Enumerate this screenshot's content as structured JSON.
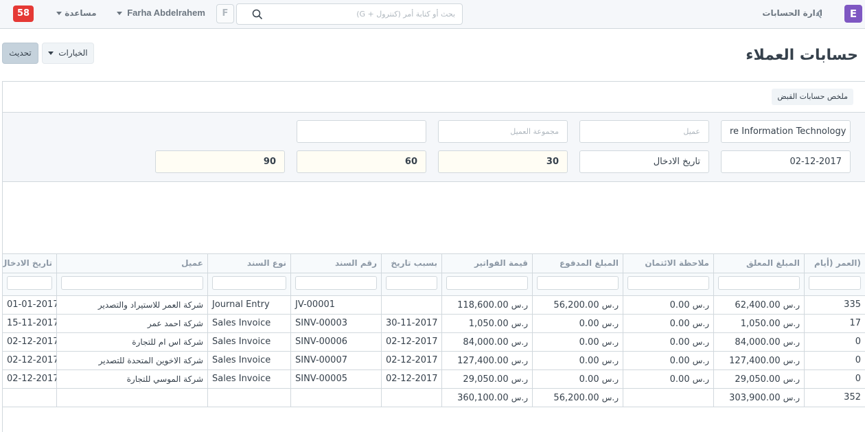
{
  "navbar": {
    "notification_count": "58",
    "help_label": "مساعدة",
    "user_name": "Farha Abdelrahem",
    "avatar_initial": "F",
    "search_placeholder": "بحث أو كتابة أمر (كنترول + G)",
    "breadcrumb": "ادارة الحسابات",
    "logo_letter": "E"
  },
  "page": {
    "title": "حسابات العملاء",
    "options_label": "الخيارات",
    "refresh_label": "تحديث",
    "summary_button": "ملخص حسابات القبض"
  },
  "filters": {
    "company": "re Information Technology",
    "customer_placeholder": "عميل",
    "customer_group_placeholder": "مجموعة العميل",
    "extra_field": "",
    "date": "02-12-2017",
    "ageing_based_on": "تاريخ الادخال",
    "range1": "30",
    "range2": "60",
    "range3": "90"
  },
  "table": {
    "columns": [
      "(العمر (أيام",
      "المبلغ المعلق",
      "ملاحظة الائتمان",
      "المبلغ المدفوع",
      "قيمة الفواتير",
      "بسبب تاريخ",
      "رقم السند",
      "نوع السند",
      "عميل",
      "تاريخ الادخال"
    ],
    "rows": [
      {
        "age": "335",
        "outstanding": "62,400.00",
        "credit_note": "0.00",
        "paid": "56,200.00",
        "invoiced": "118,600.00",
        "due_date": "",
        "voucher_no": "JV-00001",
        "voucher_type": "Journal Entry",
        "customer": "شركة العمر للاستيراد والتصدير",
        "posting_date": "01-01-2017"
      },
      {
        "age": "17",
        "outstanding": "1,050.00",
        "credit_note": "0.00",
        "paid": "0.00",
        "invoiced": "1,050.00",
        "due_date": "30-11-2017",
        "voucher_no": "SINV-00003",
        "voucher_type": "Sales Invoice",
        "customer": "شركة احمد عمر",
        "posting_date": "15-11-2017"
      },
      {
        "age": "0",
        "outstanding": "84,000.00",
        "credit_note": "0.00",
        "paid": "0.00",
        "invoiced": "84,000.00",
        "due_date": "02-12-2017",
        "voucher_no": "SINV-00006",
        "voucher_type": "Sales Invoice",
        "customer": "شركة اس ام للتجارة",
        "posting_date": "02-12-2017"
      },
      {
        "age": "0",
        "outstanding": "127,400.00",
        "credit_note": "0.00",
        "paid": "0.00",
        "invoiced": "127,400.00",
        "due_date": "02-12-2017",
        "voucher_no": "SINV-00007",
        "voucher_type": "Sales Invoice",
        "customer": "شركة الاخوين المتحدة للتصدير",
        "posting_date": "02-12-2017"
      },
      {
        "age": "0",
        "outstanding": "29,050.00",
        "credit_note": "0.00",
        "paid": "0.00",
        "invoiced": "29,050.00",
        "due_date": "02-12-2017",
        "voucher_no": "SINV-00005",
        "voucher_type": "Sales Invoice",
        "customer": "شركة الموسي للتجارة",
        "posting_date": "02-12-2017"
      }
    ],
    "totals": {
      "age": "352",
      "outstanding": "303,900.00",
      "paid": "56,200.00",
      "invoiced": "360,100.00"
    },
    "currency": "ر.س"
  }
}
